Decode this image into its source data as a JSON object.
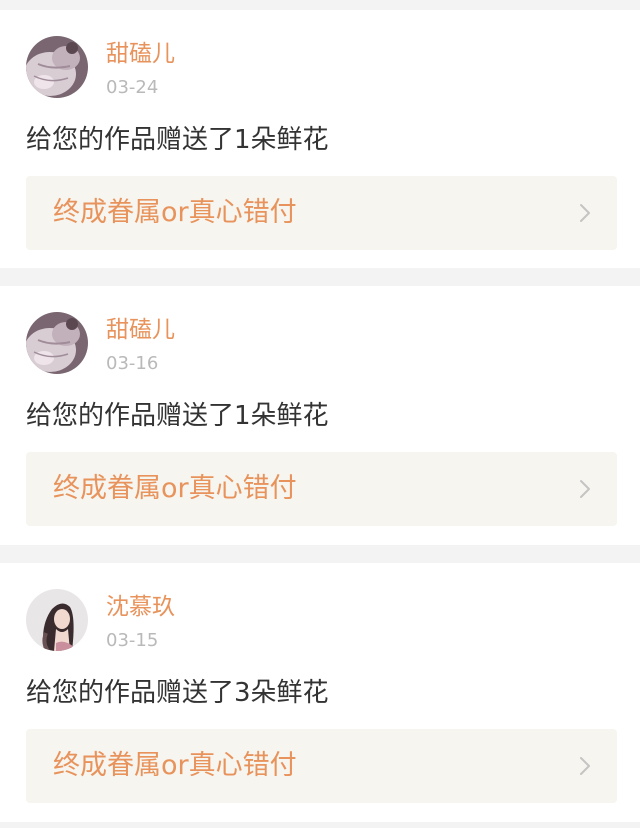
{
  "feed": {
    "items": [
      {
        "user_name": "甜磕儿",
        "date": "03-24",
        "message": "给您的作品赠送了1朵鲜花",
        "work_title": "终成眷属or真心错付",
        "avatar_icon": "avatar-plush-toy-icon"
      },
      {
        "user_name": "甜磕儿",
        "date": "03-16",
        "message": "给您的作品赠送了1朵鲜花",
        "work_title": "终成眷属or真心错付",
        "avatar_icon": "avatar-plush-toy-icon"
      },
      {
        "user_name": "沈慕玖",
        "date": "03-15",
        "message": "给您的作品赠送了3朵鲜花",
        "work_title": "终成眷属or真心错付",
        "avatar_icon": "avatar-girl-portrait-icon"
      }
    ]
  },
  "colors": {
    "accent": "#e8935c",
    "date_text": "#b9b9b9",
    "message_text": "#333333",
    "link_background": "#f6f5ef",
    "page_background": "#f3f3f3"
  }
}
